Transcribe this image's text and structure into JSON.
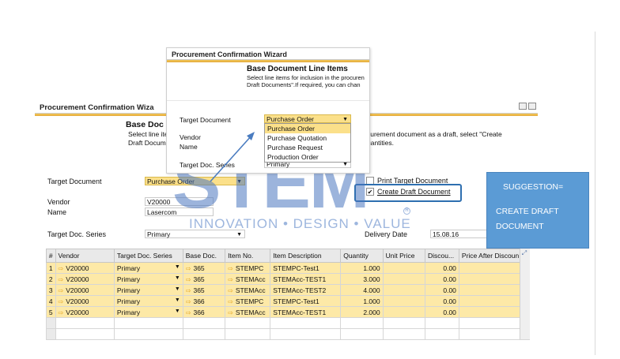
{
  "main_window": {
    "title": "Procurement Confirmation Wiza",
    "heading": "Base Doc",
    "desc_line1": "Select line ite",
    "desc_line2": "Draft Docum",
    "desc_right1": "curement document as a draft, select \"Create",
    "desc_right2": "uantities.",
    "target_document_label": "Target Document",
    "target_document_value": "Purchase Order",
    "vendor_label": "Vendor",
    "vendor_value": "V20000",
    "name_label": "Name",
    "name_value": "Lasercom",
    "series_label": "Target Doc. Series",
    "series_value": "Primary",
    "print_target_label": "Print Target Document",
    "create_draft_label": "Create Draft Document",
    "delivery_date_label": "Delivery Date",
    "delivery_date_value": "15.08.16"
  },
  "grid": {
    "headers": [
      "#",
      "Vendor",
      "Target Doc. Series",
      "Base Doc.",
      "Item No.",
      "Item Description",
      "Quantity",
      "Unit Price",
      "Discou...",
      "Price After Discoun"
    ],
    "rows": [
      {
        "n": "1",
        "vendor": "V20000",
        "series": "Primary",
        "base": "365",
        "item": "STEMPC",
        "desc": "STEMPC-Test1",
        "qty": "1.000",
        "price": "",
        "disc": "0.00"
      },
      {
        "n": "2",
        "vendor": "V20000",
        "series": "Primary",
        "base": "365",
        "item": "STEMAcc",
        "desc": "STEMAcc-TEST1",
        "qty": "3.000",
        "price": "",
        "disc": "0.00"
      },
      {
        "n": "3",
        "vendor": "V20000",
        "series": "Primary",
        "base": "365",
        "item": "STEMAcc",
        "desc": "STEMAcc-TEST2",
        "qty": "4.000",
        "price": "",
        "disc": "0.00"
      },
      {
        "n": "4",
        "vendor": "V20000",
        "series": "Primary",
        "base": "366",
        "item": "STEMPC",
        "desc": "STEMPC-Test1",
        "qty": "1.000",
        "price": "",
        "disc": "0.00"
      },
      {
        "n": "5",
        "vendor": "V20000",
        "series": "Primary",
        "base": "366",
        "item": "STEMAcc",
        "desc": "STEMAcc-TEST1",
        "qty": "2.000",
        "price": "",
        "disc": "0.00"
      }
    ]
  },
  "popup": {
    "title": "Procurement Confirmation Wizard",
    "heading": "Base Document Line Items",
    "desc_line1": "Select line items for inclusion in the procuren",
    "desc_line2": "Draft Documents\".If required, you can chan",
    "target_document_label": "Target Document",
    "target_document_value": "Purchase Order",
    "vendor_label": "Vendor",
    "name_label": "Name",
    "series_label": "Target Doc. Series",
    "series_value": "Primary",
    "options": [
      "Purchase Order",
      "Purchase Quotation",
      "Purchase Request",
      "Production Order"
    ]
  },
  "watermark": {
    "brand": "STEM",
    "tagline": "INNOVATION • DESIGN • VALUE"
  },
  "suggestion": {
    "line1": "SUGGESTION=",
    "line2": "CREATE DRAFT",
    "line3": "DOCUMENT"
  },
  "colors": {
    "suggestion_bg": "#5b9bd5",
    "highlight_border": "#2e6fb0",
    "row_yellow": "#fde9a7",
    "gold": "#e8b445"
  }
}
